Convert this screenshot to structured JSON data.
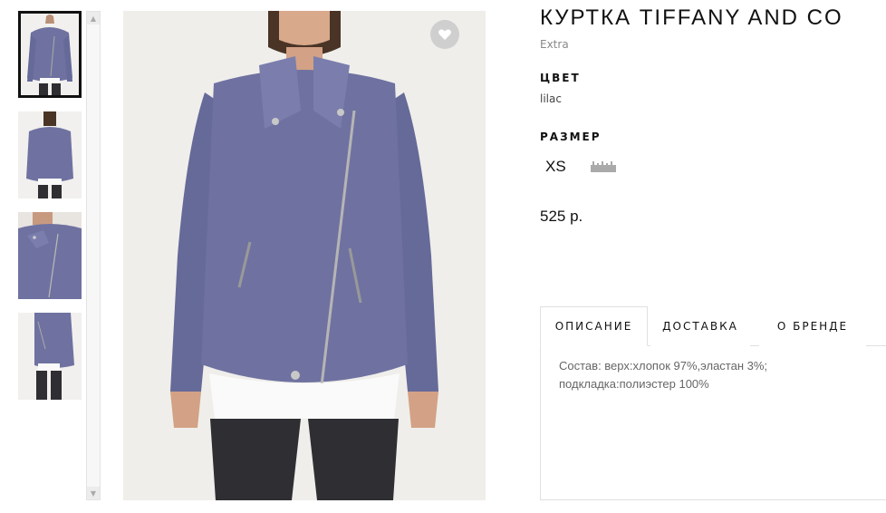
{
  "product": {
    "title": "КУРТКА TIFFANY AND CO",
    "brand": "Extra",
    "color_label": "ЦВЕТ",
    "color_value": "lilac",
    "size_label": "РАЗМЕР",
    "sizes": [
      "XS"
    ],
    "price": "525 р."
  },
  "tabs": [
    {
      "label": "ОПИСАНИЕ",
      "active": true
    },
    {
      "label": "ДОСТАВКА",
      "active": false
    },
    {
      "label": "О БРЕНДЕ",
      "active": false
    }
  ],
  "description": {
    "line1": "Состав: верх:хлопок 97%,эластан 3%;",
    "line2": "подкладка:полиэстер 100%"
  },
  "icons": {
    "favorite": "heart-icon",
    "size_guide": "ruler-icon",
    "scroll_up": "chevron-up-icon",
    "scroll_down": "chevron-down-icon"
  },
  "colors": {
    "jacket": "#6f72a0",
    "accent": "#111111"
  }
}
